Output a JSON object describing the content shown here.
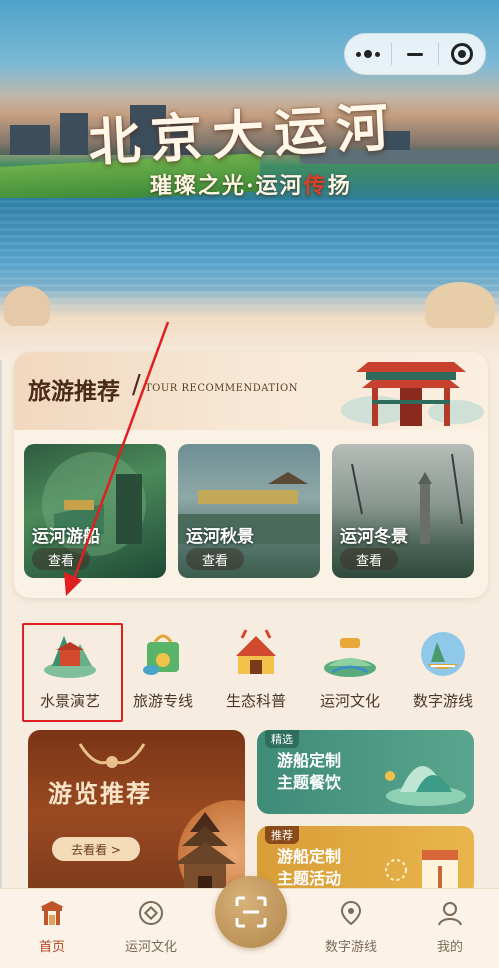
{
  "capsule": {
    "more_icon": "more-dots-icon",
    "minimize_icon": "minus-icon",
    "close_icon": "target-icon"
  },
  "hero": {
    "title": "北京大运河",
    "subtitle_part1": "璀璨之光·运河",
    "subtitle_accent": "传",
    "subtitle_part2": "扬"
  },
  "tour": {
    "title": "旅游推荐",
    "slash": "/",
    "subtitle_en": "TOUR RECOMMENDATION",
    "items": [
      {
        "label": "运河游船",
        "button": "查看"
      },
      {
        "label": "运河秋景",
        "button": "查看"
      },
      {
        "label": "运河冬景",
        "button": "查看"
      }
    ]
  },
  "categories": [
    {
      "label": "水景演艺",
      "icon": "stage-icon"
    },
    {
      "label": "旅游专线",
      "icon": "travel-bag-icon"
    },
    {
      "label": "生态科普",
      "icon": "ecology-gate-icon"
    },
    {
      "label": "运河文化",
      "icon": "culture-landscape-icon"
    },
    {
      "label": "数字游线",
      "icon": "digital-boat-icon"
    }
  ],
  "promos": {
    "big": {
      "title": "游览推荐",
      "button": "去看看 >"
    },
    "card1": {
      "tag": "精选",
      "line1": "游船定制",
      "line2": "主题餐饮"
    },
    "card2": {
      "tag": "推荐",
      "line1": "游船定制",
      "line2": "主题活动"
    }
  },
  "tabbar": {
    "items": [
      {
        "label": "首页",
        "icon": "home-gate-icon"
      },
      {
        "label": "运河文化",
        "icon": "culture-coin-icon"
      },
      {
        "label": "数字游线",
        "icon": "map-pin-icon"
      },
      {
        "label": "我的",
        "icon": "user-icon"
      }
    ],
    "scan_icon": "scan-icon"
  },
  "colors": {
    "accent": "#b3461f",
    "highlight": "#e02020",
    "brand_brown": "#4a2a18"
  }
}
